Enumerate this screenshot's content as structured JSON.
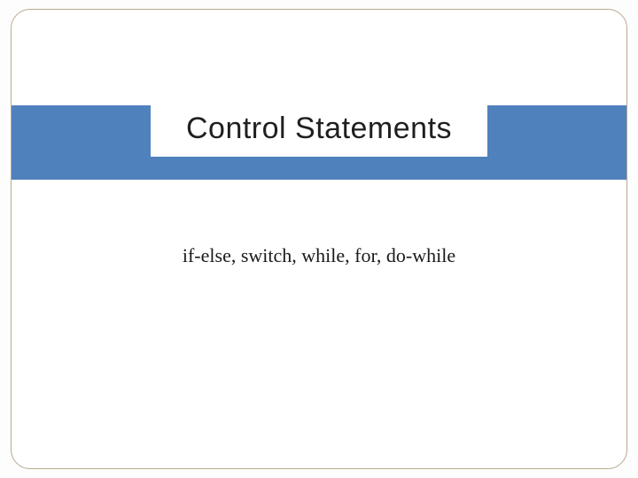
{
  "slide": {
    "title": "Control Statements",
    "subtitle": "if-else, switch, while, for, do-while"
  },
  "colors": {
    "band": "#4f81bd",
    "border": "#b8a98f"
  }
}
